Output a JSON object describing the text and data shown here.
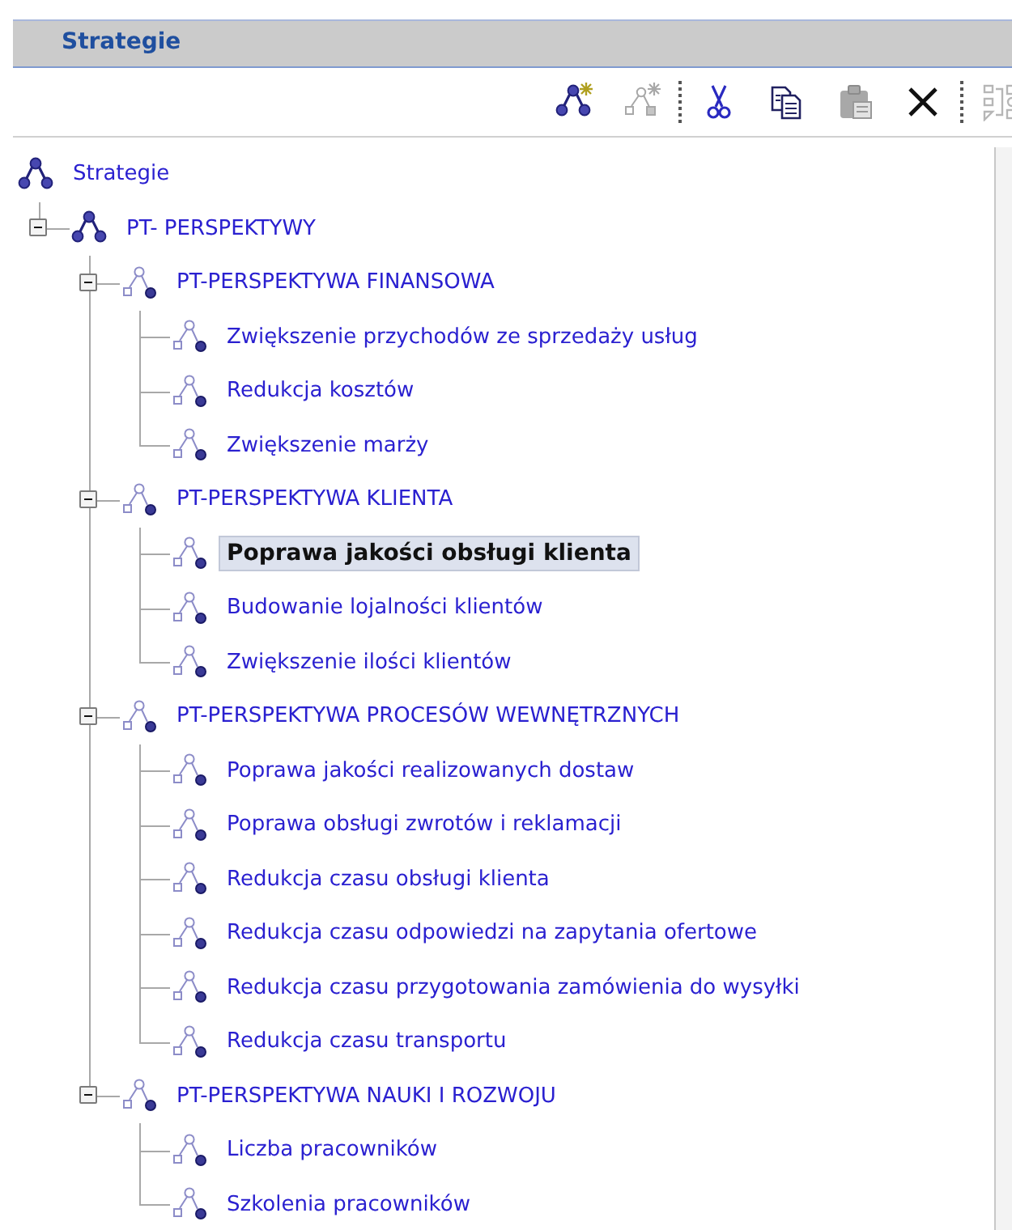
{
  "panel": {
    "title": "Strategie"
  },
  "toolbar": [
    {
      "kind": "new-node",
      "disabled": false
    },
    {
      "kind": "new-subnode",
      "disabled": true
    },
    {
      "kind": "separator"
    },
    {
      "kind": "cut",
      "disabled": false
    },
    {
      "kind": "copy",
      "disabled": false
    },
    {
      "kind": "paste",
      "disabled": true
    },
    {
      "kind": "delete",
      "disabled": false
    },
    {
      "kind": "separator"
    },
    {
      "kind": "move",
      "disabled": true
    }
  ],
  "tree": {
    "label": "Strategie",
    "selected": false,
    "children": [
      {
        "label": "PT- PERSPEKTYWY",
        "selected": false,
        "expanded": true,
        "children": [
          {
            "label": "PT-PERSPEKTYWA FINANSOWA",
            "selected": false,
            "expanded": true,
            "children": [
              {
                "label": "Zwiększenie przychodów ze sprzedaży usług",
                "selected": false
              },
              {
                "label": "Redukcja kosztów",
                "selected": false
              },
              {
                "label": "Zwiększenie marży",
                "selected": false
              }
            ]
          },
          {
            "label": "PT-PERSPEKTYWA KLIENTA",
            "selected": false,
            "expanded": true,
            "children": [
              {
                "label": "Poprawa jakości obsługi klienta",
                "selected": true
              },
              {
                "label": "Budowanie lojalności klientów",
                "selected": false
              },
              {
                "label": "Zwiększenie ilości klientów",
                "selected": false
              }
            ]
          },
          {
            "label": "PT-PERSPEKTYWA PROCESÓW WEWNĘTRZNYCH",
            "selected": false,
            "expanded": true,
            "children": [
              {
                "label": "Poprawa jakości realizowanych dostaw",
                "selected": false
              },
              {
                "label": "Poprawa obsługi zwrotów i reklamacji",
                "selected": false
              },
              {
                "label": "Redukcja czasu obsługi klienta",
                "selected": false
              },
              {
                "label": "Redukcja czasu odpowiedzi na zapytania ofertowe",
                "selected": false
              },
              {
                "label": "Redukcja czasu przygotowania zamówienia do wysyłki",
                "selected": false
              },
              {
                "label": "Redukcja czasu transportu",
                "selected": false
              }
            ]
          },
          {
            "label": "PT-PERSPEKTYWA NAUKI I ROZWOJU",
            "selected": false,
            "expanded": true,
            "children": [
              {
                "label": "Liczba pracowników",
                "selected": false
              },
              {
                "label": "Szkolenia pracowników",
                "selected": false
              }
            ]
          }
        ]
      }
    ]
  }
}
